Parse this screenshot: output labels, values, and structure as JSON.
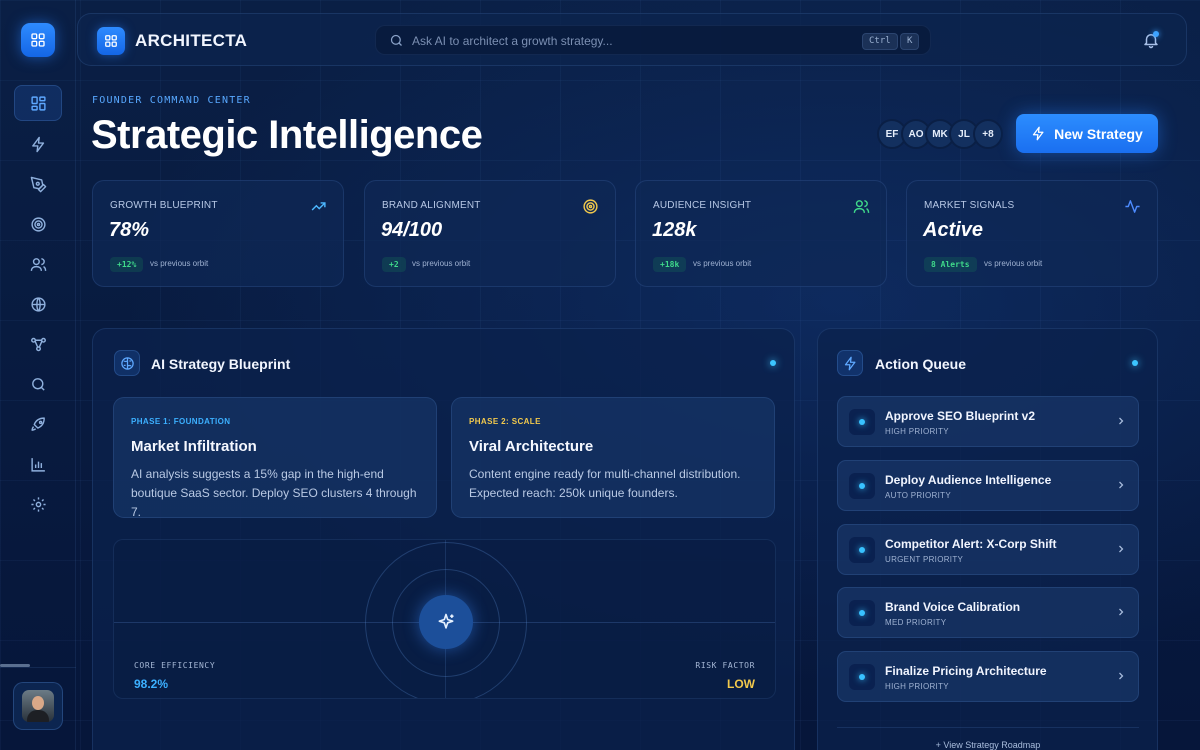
{
  "app": {
    "name": "ARCHITECTA"
  },
  "search": {
    "placeholder": "Ask AI to architect a growth strategy...",
    "shortcut_1": "Ctrl",
    "shortcut_2": "K"
  },
  "header": {
    "eyebrow": "FOUNDER COMMAND CENTER",
    "title": "Strategic Intelligence",
    "team": [
      "EF",
      "AO",
      "MK",
      "JL",
      "+8"
    ],
    "new_button": "New Strategy"
  },
  "kpis": [
    {
      "label": "GROWTH BLUEPRINT",
      "value": "78%",
      "badge": "+12%",
      "sub": "vs previous orbit",
      "icon": "trending-up-icon",
      "color": "#4db8ff"
    },
    {
      "label": "BRAND ALIGNMENT",
      "value": "94/100",
      "badge": "+2",
      "sub": "vs previous orbit",
      "icon": "target-icon",
      "color": "#f2c94c"
    },
    {
      "label": "AUDIENCE INSIGHT",
      "value": "128k",
      "badge": "+18k",
      "sub": "vs previous orbit",
      "icon": "users-icon",
      "color": "#3fd98a"
    },
    {
      "label": "MARKET SIGNALS",
      "value": "Active",
      "badge": "8 Alerts",
      "sub": "vs previous orbit",
      "icon": "activity-icon",
      "color": "#4d8bff"
    }
  ],
  "blueprint": {
    "title": "AI Strategy Blueprint",
    "phases": [
      {
        "tag": "PHASE 1: FOUNDATION",
        "title": "Market Infiltration",
        "desc": "AI analysis suggests a 15% gap in the high-end boutique SaaS sector. Deploy SEO clusters 4 through 7.",
        "color": "#3cb0ff"
      },
      {
        "tag": "PHASE 2: SCALE",
        "title": "Viral Architecture",
        "desc": "Content engine ready for multi-channel distribution. Expected reach: 250k unique founders.",
        "color": "#f2c94c"
      }
    ],
    "core_label": "CORE EFFICIENCY",
    "core_value": "98.2%",
    "risk_label": "RISK FACTOR",
    "risk_value": "LOW"
  },
  "queue": {
    "title": "Action Queue",
    "items": [
      {
        "title": "Approve SEO Blueprint v2",
        "priority": "HIGH PRIORITY"
      },
      {
        "title": "Deploy Audience Intelligence",
        "priority": "AUTO PRIORITY"
      },
      {
        "title": "Competitor Alert: X-Corp Shift",
        "priority": "URGENT PRIORITY"
      },
      {
        "title": "Brand Voice Calibration",
        "priority": "MED PRIORITY"
      },
      {
        "title": "Finalize Pricing Architecture",
        "priority": "HIGH PRIORITY"
      }
    ],
    "footer": "+ View Strategy Roadmap"
  },
  "theme": {
    "accent": "#2c8dff",
    "background": "#061634",
    "success": "#3fd98a"
  }
}
